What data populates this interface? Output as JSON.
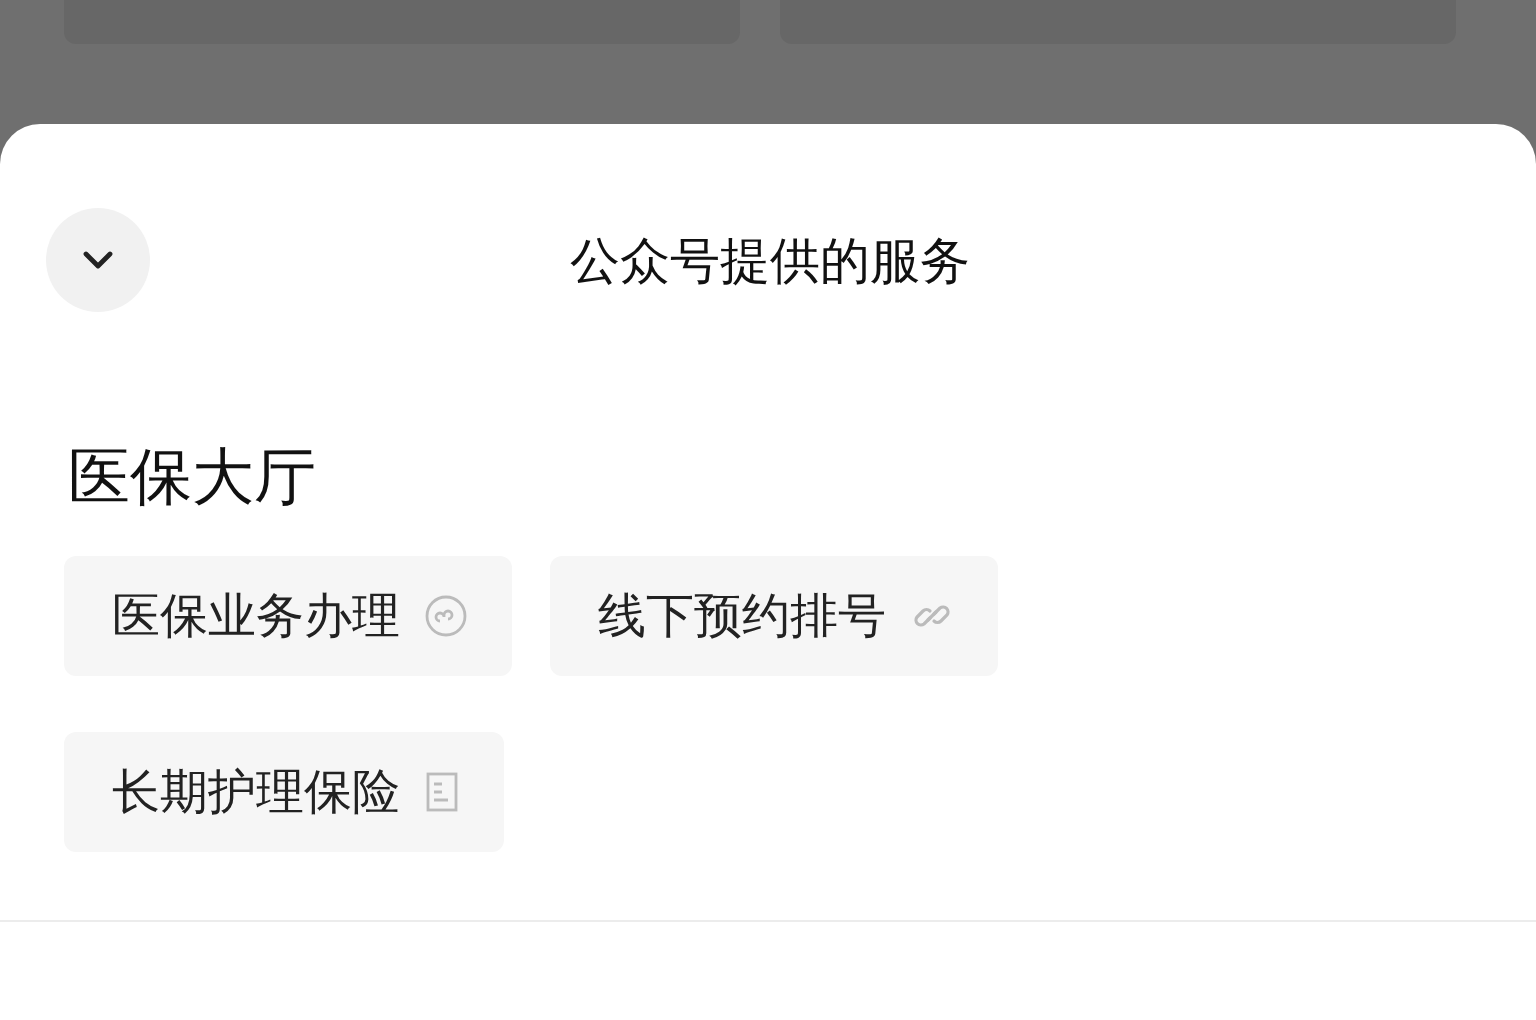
{
  "sheet": {
    "title": "公众号提供的服务",
    "section": {
      "heading": "医保大厅",
      "services": [
        {
          "label": "医保业务办理",
          "kind": "miniprogram"
        },
        {
          "label": "线下预约排号",
          "kind": "link"
        },
        {
          "label": "长期护理保险",
          "kind": "article"
        }
      ]
    }
  }
}
